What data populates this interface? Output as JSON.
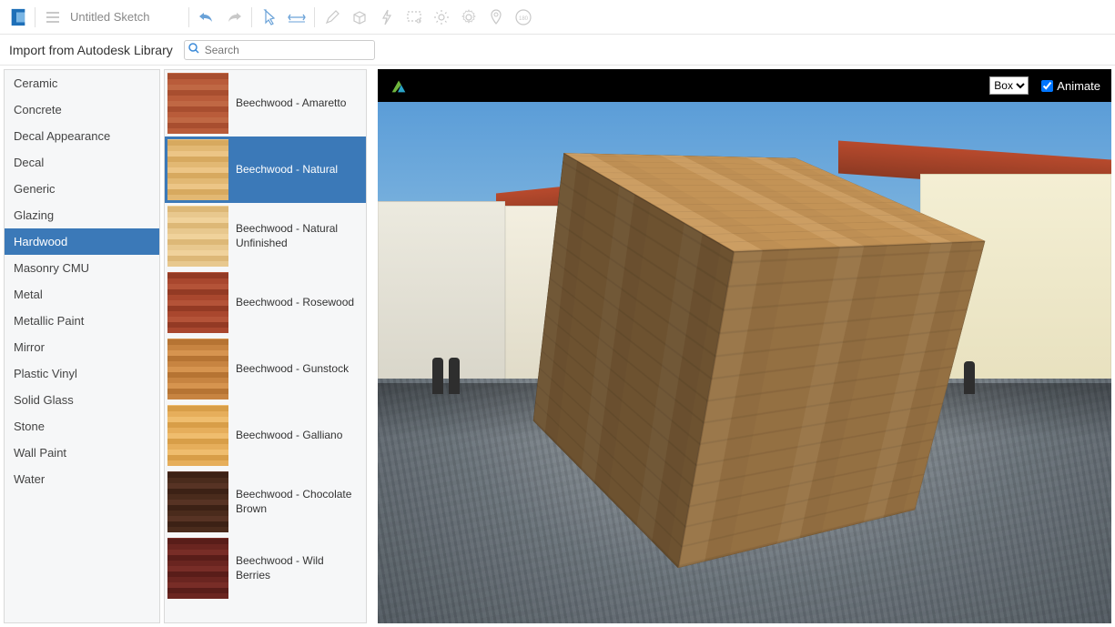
{
  "header": {
    "title": "Untitled Sketch",
    "toolIcons": [
      "menu",
      "undo",
      "redo",
      "cursor",
      "dimension",
      "pencil",
      "box-3d",
      "lightning",
      "stamp",
      "sun",
      "gear",
      "pin",
      "badge-180"
    ]
  },
  "subheader": {
    "title": "Import from Autodesk Library",
    "searchPlaceholder": "Search"
  },
  "categories": [
    {
      "label": "Ceramic",
      "selected": false
    },
    {
      "label": "Concrete",
      "selected": false
    },
    {
      "label": "Decal Appearance",
      "selected": false
    },
    {
      "label": "Decal",
      "selected": false
    },
    {
      "label": "Generic",
      "selected": false
    },
    {
      "label": "Glazing",
      "selected": false
    },
    {
      "label": "Hardwood",
      "selected": true
    },
    {
      "label": "Masonry CMU",
      "selected": false
    },
    {
      "label": "Metal",
      "selected": false
    },
    {
      "label": "Metallic Paint",
      "selected": false
    },
    {
      "label": "Mirror",
      "selected": false
    },
    {
      "label": "Plastic Vinyl",
      "selected": false
    },
    {
      "label": "Solid Glass",
      "selected": false
    },
    {
      "label": "Stone",
      "selected": false
    },
    {
      "label": "Wall Paint",
      "selected": false
    },
    {
      "label": "Water",
      "selected": false
    }
  ],
  "materials": [
    {
      "label": "Beechwood - Amaretto",
      "swatch": "sw-amaretto",
      "selected": false
    },
    {
      "label": "Beechwood - Natural",
      "swatch": "sw-natural",
      "selected": true
    },
    {
      "label": "Beechwood - Natural Unfinished",
      "swatch": "sw-unfinished",
      "selected": false
    },
    {
      "label": "Beechwood - Rosewood",
      "swatch": "sw-rosewood",
      "selected": false
    },
    {
      "label": "Beechwood - Gunstock",
      "swatch": "sw-gunstock",
      "selected": false
    },
    {
      "label": "Beechwood - Galliano",
      "swatch": "sw-galliano",
      "selected": false
    },
    {
      "label": "Beechwood - Chocolate Brown",
      "swatch": "sw-chocolate",
      "selected": false
    },
    {
      "label": "Beechwood - Wild Berries",
      "swatch": "sw-wildberries",
      "selected": false
    }
  ],
  "preview": {
    "shapeOptions": [
      "Box"
    ],
    "shapeSelected": "Box",
    "animateLabel": "Animate",
    "animateChecked": true
  }
}
